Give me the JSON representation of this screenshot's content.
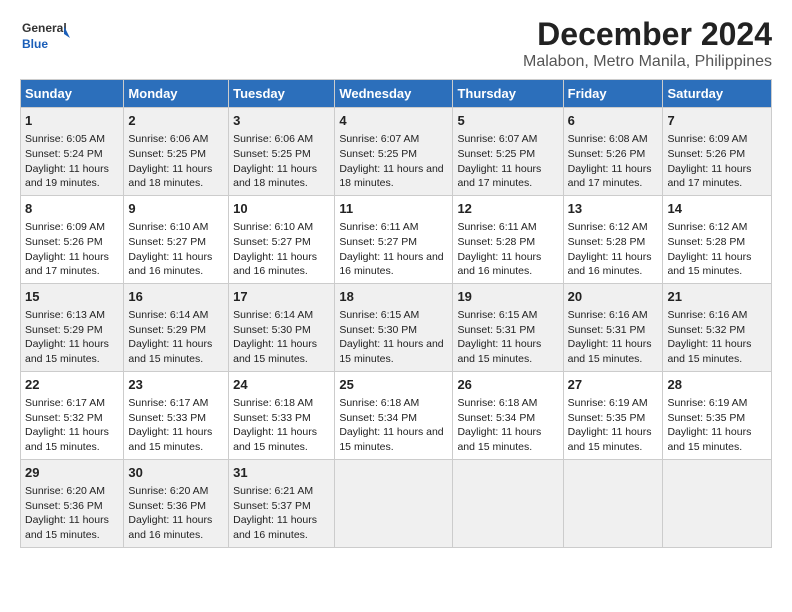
{
  "header": {
    "logo_line1": "General",
    "logo_line2": "Blue",
    "title": "December 2024",
    "subtitle": "Malabon, Metro Manila, Philippines"
  },
  "weekdays": [
    "Sunday",
    "Monday",
    "Tuesday",
    "Wednesday",
    "Thursday",
    "Friday",
    "Saturday"
  ],
  "weeks": [
    [
      {
        "day": "1",
        "info": "Sunrise: 6:05 AM\nSunset: 5:24 PM\nDaylight: 11 hours and 19 minutes."
      },
      {
        "day": "2",
        "info": "Sunrise: 6:06 AM\nSunset: 5:25 PM\nDaylight: 11 hours and 18 minutes."
      },
      {
        "day": "3",
        "info": "Sunrise: 6:06 AM\nSunset: 5:25 PM\nDaylight: 11 hours and 18 minutes."
      },
      {
        "day": "4",
        "info": "Sunrise: 6:07 AM\nSunset: 5:25 PM\nDaylight: 11 hours and 18 minutes."
      },
      {
        "day": "5",
        "info": "Sunrise: 6:07 AM\nSunset: 5:25 PM\nDaylight: 11 hours and 17 minutes."
      },
      {
        "day": "6",
        "info": "Sunrise: 6:08 AM\nSunset: 5:26 PM\nDaylight: 11 hours and 17 minutes."
      },
      {
        "day": "7",
        "info": "Sunrise: 6:09 AM\nSunset: 5:26 PM\nDaylight: 11 hours and 17 minutes."
      }
    ],
    [
      {
        "day": "8",
        "info": "Sunrise: 6:09 AM\nSunset: 5:26 PM\nDaylight: 11 hours and 17 minutes."
      },
      {
        "day": "9",
        "info": "Sunrise: 6:10 AM\nSunset: 5:27 PM\nDaylight: 11 hours and 16 minutes."
      },
      {
        "day": "10",
        "info": "Sunrise: 6:10 AM\nSunset: 5:27 PM\nDaylight: 11 hours and 16 minutes."
      },
      {
        "day": "11",
        "info": "Sunrise: 6:11 AM\nSunset: 5:27 PM\nDaylight: 11 hours and 16 minutes."
      },
      {
        "day": "12",
        "info": "Sunrise: 6:11 AM\nSunset: 5:28 PM\nDaylight: 11 hours and 16 minutes."
      },
      {
        "day": "13",
        "info": "Sunrise: 6:12 AM\nSunset: 5:28 PM\nDaylight: 11 hours and 16 minutes."
      },
      {
        "day": "14",
        "info": "Sunrise: 6:12 AM\nSunset: 5:28 PM\nDaylight: 11 hours and 15 minutes."
      }
    ],
    [
      {
        "day": "15",
        "info": "Sunrise: 6:13 AM\nSunset: 5:29 PM\nDaylight: 11 hours and 15 minutes."
      },
      {
        "day": "16",
        "info": "Sunrise: 6:14 AM\nSunset: 5:29 PM\nDaylight: 11 hours and 15 minutes."
      },
      {
        "day": "17",
        "info": "Sunrise: 6:14 AM\nSunset: 5:30 PM\nDaylight: 11 hours and 15 minutes."
      },
      {
        "day": "18",
        "info": "Sunrise: 6:15 AM\nSunset: 5:30 PM\nDaylight: 11 hours and 15 minutes."
      },
      {
        "day": "19",
        "info": "Sunrise: 6:15 AM\nSunset: 5:31 PM\nDaylight: 11 hours and 15 minutes."
      },
      {
        "day": "20",
        "info": "Sunrise: 6:16 AM\nSunset: 5:31 PM\nDaylight: 11 hours and 15 minutes."
      },
      {
        "day": "21",
        "info": "Sunrise: 6:16 AM\nSunset: 5:32 PM\nDaylight: 11 hours and 15 minutes."
      }
    ],
    [
      {
        "day": "22",
        "info": "Sunrise: 6:17 AM\nSunset: 5:32 PM\nDaylight: 11 hours and 15 minutes."
      },
      {
        "day": "23",
        "info": "Sunrise: 6:17 AM\nSunset: 5:33 PM\nDaylight: 11 hours and 15 minutes."
      },
      {
        "day": "24",
        "info": "Sunrise: 6:18 AM\nSunset: 5:33 PM\nDaylight: 11 hours and 15 minutes."
      },
      {
        "day": "25",
        "info": "Sunrise: 6:18 AM\nSunset: 5:34 PM\nDaylight: 11 hours and 15 minutes."
      },
      {
        "day": "26",
        "info": "Sunrise: 6:18 AM\nSunset: 5:34 PM\nDaylight: 11 hours and 15 minutes."
      },
      {
        "day": "27",
        "info": "Sunrise: 6:19 AM\nSunset: 5:35 PM\nDaylight: 11 hours and 15 minutes."
      },
      {
        "day": "28",
        "info": "Sunrise: 6:19 AM\nSunset: 5:35 PM\nDaylight: 11 hours and 15 minutes."
      }
    ],
    [
      {
        "day": "29",
        "info": "Sunrise: 6:20 AM\nSunset: 5:36 PM\nDaylight: 11 hours and 15 minutes."
      },
      {
        "day": "30",
        "info": "Sunrise: 6:20 AM\nSunset: 5:36 PM\nDaylight: 11 hours and 16 minutes."
      },
      {
        "day": "31",
        "info": "Sunrise: 6:21 AM\nSunset: 5:37 PM\nDaylight: 11 hours and 16 minutes."
      },
      null,
      null,
      null,
      null
    ]
  ]
}
